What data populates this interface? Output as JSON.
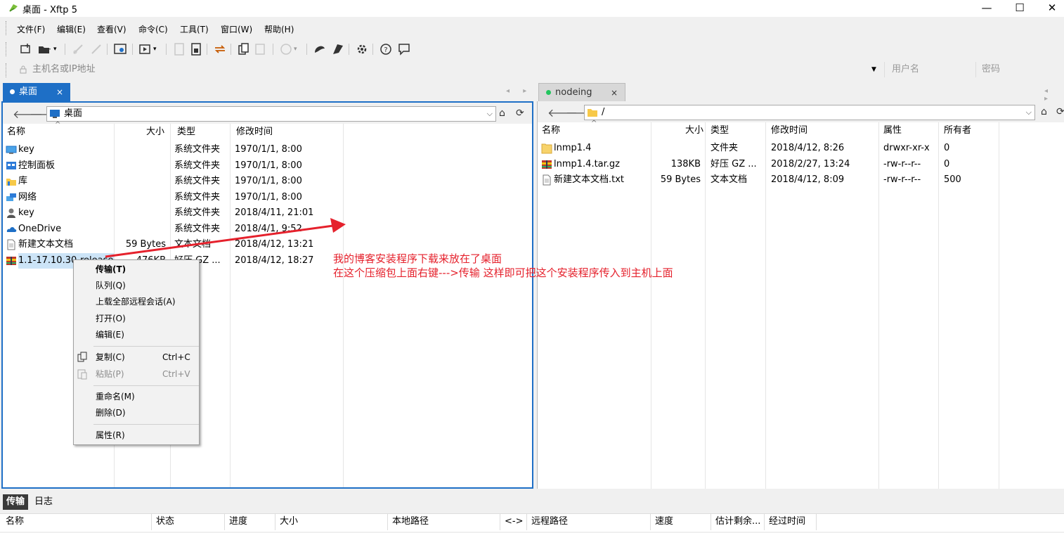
{
  "window": {
    "title": "桌面 - Xftp 5",
    "minimize": "—",
    "maximize": "☐",
    "close": "✕"
  },
  "menu": [
    "文件(F)",
    "编辑(E)",
    "查看(V)",
    "命令(C)",
    "工具(T)",
    "窗口(W)",
    "帮助(H)"
  ],
  "toolbar_icons": [
    "new-session-icon",
    "open-folder-icon",
    "disconnect-icon",
    "reconnect-icon",
    "session-properties-icon",
    "transfer-icon",
    "upload-icon",
    "download-icon",
    "sync-icon",
    "copy-icon",
    "paste-icon",
    "encoding-icon",
    "xshell-icon",
    "xftp-icon",
    "settings-icon",
    "help-icon",
    "chat-icon"
  ],
  "address": {
    "placeholder": "主机名或IP地址",
    "user_placeholder": "用户名",
    "password_placeholder": "密码"
  },
  "left_tab": {
    "label": "桌面",
    "close": "×",
    "dot_color": "#ffffff",
    "nav": "◂ ▸"
  },
  "right_tab": {
    "label": "nodeing",
    "close": "×",
    "dot_color": "#22c55e",
    "nav": "◂ ▸"
  },
  "left_pane": {
    "path": "桌面",
    "columns": {
      "name": "名称",
      "size": "大小",
      "type": "类型",
      "modified": "修改时间"
    },
    "files": [
      {
        "name": "key",
        "size": "",
        "type": "系统文件夹",
        "modified": "1970/1/1, 8:00",
        "icon": "desktop-icon"
      },
      {
        "name": "控制面板",
        "size": "",
        "type": "系统文件夹",
        "modified": "1970/1/1, 8:00",
        "icon": "control-panel-icon"
      },
      {
        "name": "库",
        "size": "",
        "type": "系统文件夹",
        "modified": "1970/1/1, 8:00",
        "icon": "library-icon"
      },
      {
        "name": "网络",
        "size": "",
        "type": "系统文件夹",
        "modified": "1970/1/1, 8:00",
        "icon": "network-icon"
      },
      {
        "name": "key",
        "size": "",
        "type": "系统文件夹",
        "modified": "2018/4/11, 21:01",
        "icon": "user-icon"
      },
      {
        "name": "OneDrive",
        "size": "",
        "type": "系统文件夹",
        "modified": "2018/4/1, 9:52",
        "icon": "onedrive-icon"
      },
      {
        "name": "新建文本文档",
        "size": "59 Bytes",
        "type": "文本文档",
        "modified": "2018/4/12, 13:21",
        "icon": "text-file-icon"
      },
      {
        "name": "1.1-17.10.30-release",
        "size": "476KB",
        "type": "好压 GZ ...",
        "modified": "2018/4/12, 18:27",
        "icon": "archive-icon"
      }
    ]
  },
  "right_pane": {
    "path": "/",
    "columns": {
      "name": "名称",
      "size": "大小",
      "type": "类型",
      "modified": "修改时间",
      "attr": "属性",
      "owner": "所有者"
    },
    "files": [
      {
        "name": "lnmp1.4",
        "size": "",
        "type": "文件夹",
        "modified": "2018/4/12, 8:26",
        "attr": "drwxr-xr-x",
        "owner": "0",
        "icon": "folder-icon"
      },
      {
        "name": "lnmp1.4.tar.gz",
        "size": "138KB",
        "type": "好压 GZ ...",
        "modified": "2018/2/27, 13:24",
        "attr": "-rw-r--r--",
        "owner": "0",
        "icon": "archive-icon"
      },
      {
        "name": "新建文本文档.txt",
        "size": "59 Bytes",
        "type": "文本文档",
        "modified": "2018/4/12, 8:09",
        "attr": "-rw-r--r--",
        "owner": "500",
        "icon": "text-file-icon"
      }
    ]
  },
  "context_menu": [
    {
      "label": "传输(T)",
      "shortcut": "",
      "bold": true
    },
    {
      "label": "队列(Q)",
      "shortcut": ""
    },
    {
      "label": "上载全部远程会话(A)",
      "shortcut": ""
    },
    {
      "label": "打开(O)",
      "shortcut": ""
    },
    {
      "label": "编辑(E)",
      "shortcut": ""
    },
    {
      "label": "复制(C)",
      "shortcut": "Ctrl+C"
    },
    {
      "label": "粘贴(P)",
      "shortcut": "Ctrl+V",
      "disabled": true
    },
    {
      "label": "重命名(M)",
      "shortcut": ""
    },
    {
      "label": "删除(D)",
      "shortcut": ""
    },
    {
      "label": "属性(R)",
      "shortcut": ""
    }
  ],
  "annotation": {
    "line1": "我的博客安装程序下载来放在了桌面",
    "line2": "在这个压缩包上面右键--->传输  这样即可把这个安装程序传入到主机上面",
    "color": "#e5212c"
  },
  "bottom": {
    "tabs": [
      "传输",
      "日志"
    ],
    "columns": [
      "名称",
      "状态",
      "进度",
      "大小",
      "本地路径",
      "<->",
      "远程路径",
      "速度",
      "估计剩余...",
      "经过时间"
    ]
  },
  "colors": {
    "accent": "#1e6fc6",
    "annotation": "#e5212c"
  }
}
